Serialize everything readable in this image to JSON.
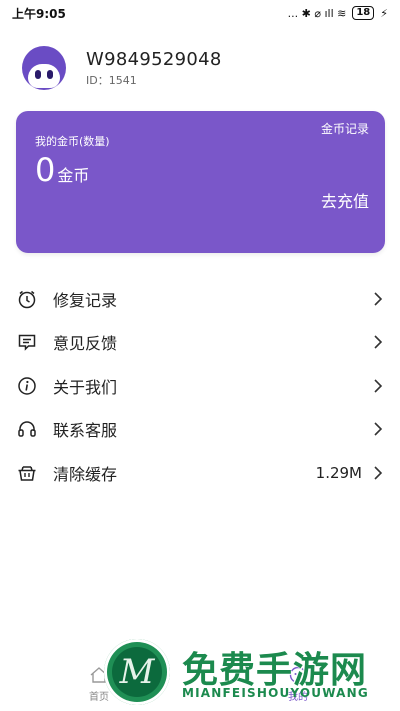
{
  "status_bar": {
    "time": "上午9:05",
    "indicators": "... ✱ ⌀ ıll ≋",
    "battery": "18"
  },
  "profile": {
    "username": "W9849529048",
    "user_id": "ID：1541"
  },
  "coin_card": {
    "record_link": "金币记录",
    "label": "我的金币(数量)",
    "amount": "0",
    "unit": "金币",
    "recharge": "去充值",
    "color": "#7a57c9"
  },
  "menu": {
    "items": [
      {
        "label": "修复记录",
        "icon": "clock-icon"
      },
      {
        "label": "意见反馈",
        "icon": "feedback-icon"
      },
      {
        "label": "关于我们",
        "icon": "info-icon"
      },
      {
        "label": "联系客服",
        "icon": "headset-icon"
      },
      {
        "label": "清除缓存",
        "icon": "basket-icon",
        "value": "1.29M"
      }
    ]
  },
  "bottom_nav": {
    "home_label": "首页",
    "mine_label": "我的"
  },
  "watermark": {
    "logo_letter": "M",
    "title": "免费手游网",
    "subtitle": "MIANFEISHOUYOUWANG"
  }
}
